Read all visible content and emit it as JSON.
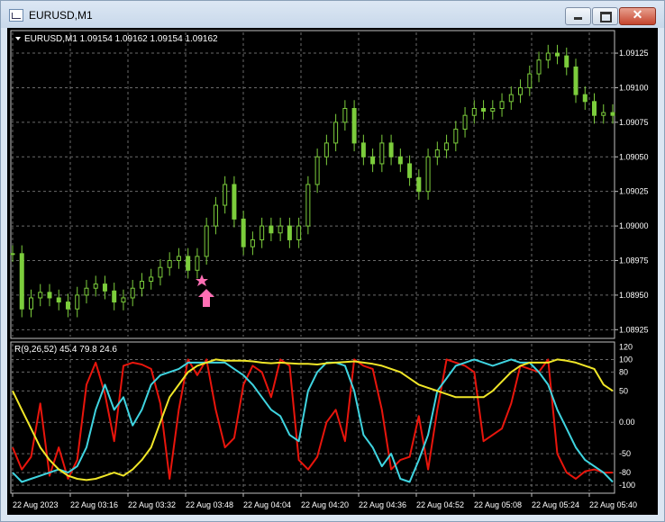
{
  "window": {
    "title": "EURUSD,M1",
    "close_glyph": "✕",
    "icons": [
      "chart-window-icon",
      "minimize-icon",
      "maximize-icon",
      "close-icon",
      "dropdown-triangle-icon",
      "buy-arrow-icon",
      "star-icon"
    ]
  },
  "main_chart": {
    "symbol_info": "EURUSD,M1  1.09154 1.09162 1.09154 1.09162",
    "price_ticks": [
      "1.09125",
      "1.09100",
      "1.09075",
      "1.09050",
      "1.09025",
      "1.09000",
      "1.08975",
      "1.08950",
      "1.08925"
    ],
    "candle_color": "#7ccd3c"
  },
  "indicator": {
    "label": "R(9,26,52) 45.4 79.8 24.6",
    "level_ticks": [
      "120",
      "100",
      "80",
      "50",
      "0.00",
      "-50",
      "-80",
      "-100"
    ],
    "colors": {
      "fast": "#e8150c",
      "medium": "#3fd4e0",
      "slow": "#f0e628"
    }
  },
  "time_axis": {
    "labels": [
      "22 Aug 2023",
      "22 Aug 03:16",
      "22 Aug 03:32",
      "22 Aug 03:48",
      "22 Aug 04:04",
      "22 Aug 04:20",
      "22 Aug 04:36",
      "22 Aug 04:52",
      "22 Aug 05:08",
      "22 Aug 05:24",
      "22 Aug 05:40"
    ]
  },
  "chart_data": {
    "type": "line",
    "x": [
      "02:59",
      "03:02",
      "03:04",
      "03:06",
      "03:09",
      "03:11",
      "03:14",
      "03:16",
      "03:19",
      "03:21",
      "03:24",
      "03:26",
      "03:29",
      "03:32",
      "03:34",
      "03:36",
      "03:39",
      "03:41",
      "03:44",
      "03:47",
      "03:49",
      "03:51",
      "03:54",
      "03:56",
      "03:59",
      "04:02",
      "04:04",
      "04:06",
      "04:09",
      "04:11",
      "04:14",
      "04:16",
      "04:19",
      "04:21",
      "04:24",
      "04:26",
      "04:29",
      "04:31",
      "04:34",
      "04:36",
      "04:39",
      "04:41",
      "04:44",
      "04:46",
      "04:49",
      "04:51",
      "04:54",
      "04:56",
      "04:59",
      "05:01",
      "05:04",
      "05:07",
      "05:09",
      "05:11",
      "05:14",
      "05:17",
      "05:19",
      "05:21",
      "05:24",
      "05:27",
      "05:29",
      "05:31",
      "05:34",
      "05:36",
      "05:39",
      "05:41"
    ],
    "series": [
      {
        "values": [
          1.0898,
          1.0894,
          1.08948,
          1.08952,
          1.08948,
          1.08945,
          1.0894,
          1.0895,
          1.08955,
          1.08958,
          1.08953,
          1.08945,
          1.08948,
          1.08955,
          1.0896,
          1.08963,
          1.0897,
          1.08975,
          1.08978,
          1.08968,
          1.08978,
          1.09,
          1.09015,
          1.0903,
          1.09005,
          1.08985,
          1.0899,
          1.09,
          1.08995,
          1.09,
          1.0899,
          1.09,
          1.0903,
          1.0905,
          1.0906,
          1.09075,
          1.09085,
          1.0906,
          1.0905,
          1.09045,
          1.0906,
          1.0905,
          1.09045,
          1.09035,
          1.09025,
          1.0905,
          1.09055,
          1.0906,
          1.0907,
          1.0908,
          1.09085,
          1.09083,
          1.09085,
          1.0909,
          1.09095,
          1.091,
          1.0911,
          1.0912,
          1.09125,
          1.09123,
          1.09115,
          1.09095,
          1.0909,
          1.0908,
          1.09082,
          1.0908
        ]
      },
      {
        "values": [
          -40,
          -75,
          -55,
          30,
          -85,
          -40,
          -90,
          -60,
          60,
          95,
          45,
          -30,
          90,
          95,
          92,
          85,
          30,
          -90,
          20,
          100,
          75,
          100,
          20,
          -40,
          -25,
          60,
          90,
          80,
          40,
          100,
          90,
          -60,
          -75,
          -55,
          0,
          20,
          -30,
          100,
          90,
          85,
          20,
          -75,
          -60,
          -55,
          10,
          -75,
          20,
          100,
          95,
          90,
          80,
          -30,
          -20,
          -10,
          30,
          90,
          85,
          80,
          100,
          -50,
          -80,
          -90,
          -78,
          -75,
          -80,
          -80
        ]
      },
      {
        "values": [
          -80,
          -95,
          -90,
          -85,
          -80,
          -75,
          -80,
          -70,
          -40,
          20,
          60,
          20,
          40,
          -5,
          20,
          60,
          75,
          80,
          85,
          95,
          95,
          95,
          95,
          95,
          85,
          75,
          60,
          40,
          20,
          10,
          -20,
          -30,
          50,
          80,
          95,
          95,
          90,
          50,
          -20,
          -40,
          -70,
          -50,
          -90,
          -95,
          -60,
          -20,
          50,
          70,
          90,
          95,
          100,
          95,
          90,
          95,
          100,
          95,
          95,
          80,
          60,
          20,
          -10,
          -40,
          -60,
          -70,
          -80,
          -95
        ]
      },
      {
        "values": [
          50,
          20,
          -10,
          -40,
          -60,
          -75,
          -85,
          -90,
          -92,
          -90,
          -85,
          -80,
          -85,
          -75,
          -60,
          -40,
          0,
          40,
          60,
          80,
          90,
          95,
          100,
          98,
          98,
          98,
          97,
          95,
          94,
          95,
          94,
          93,
          93,
          92,
          94,
          95,
          96,
          97,
          95,
          93,
          90,
          85,
          80,
          70,
          60,
          55,
          50,
          45,
          40,
          40,
          40,
          40,
          50,
          65,
          80,
          90,
          95,
          95,
          95,
          100,
          98,
          95,
          90,
          85,
          60,
          50
        ]
      }
    ],
    "yrange_price": [
      1.0892,
      1.0914
    ],
    "yrange_indicator": [
      -110,
      125
    ],
    "grid": true
  }
}
